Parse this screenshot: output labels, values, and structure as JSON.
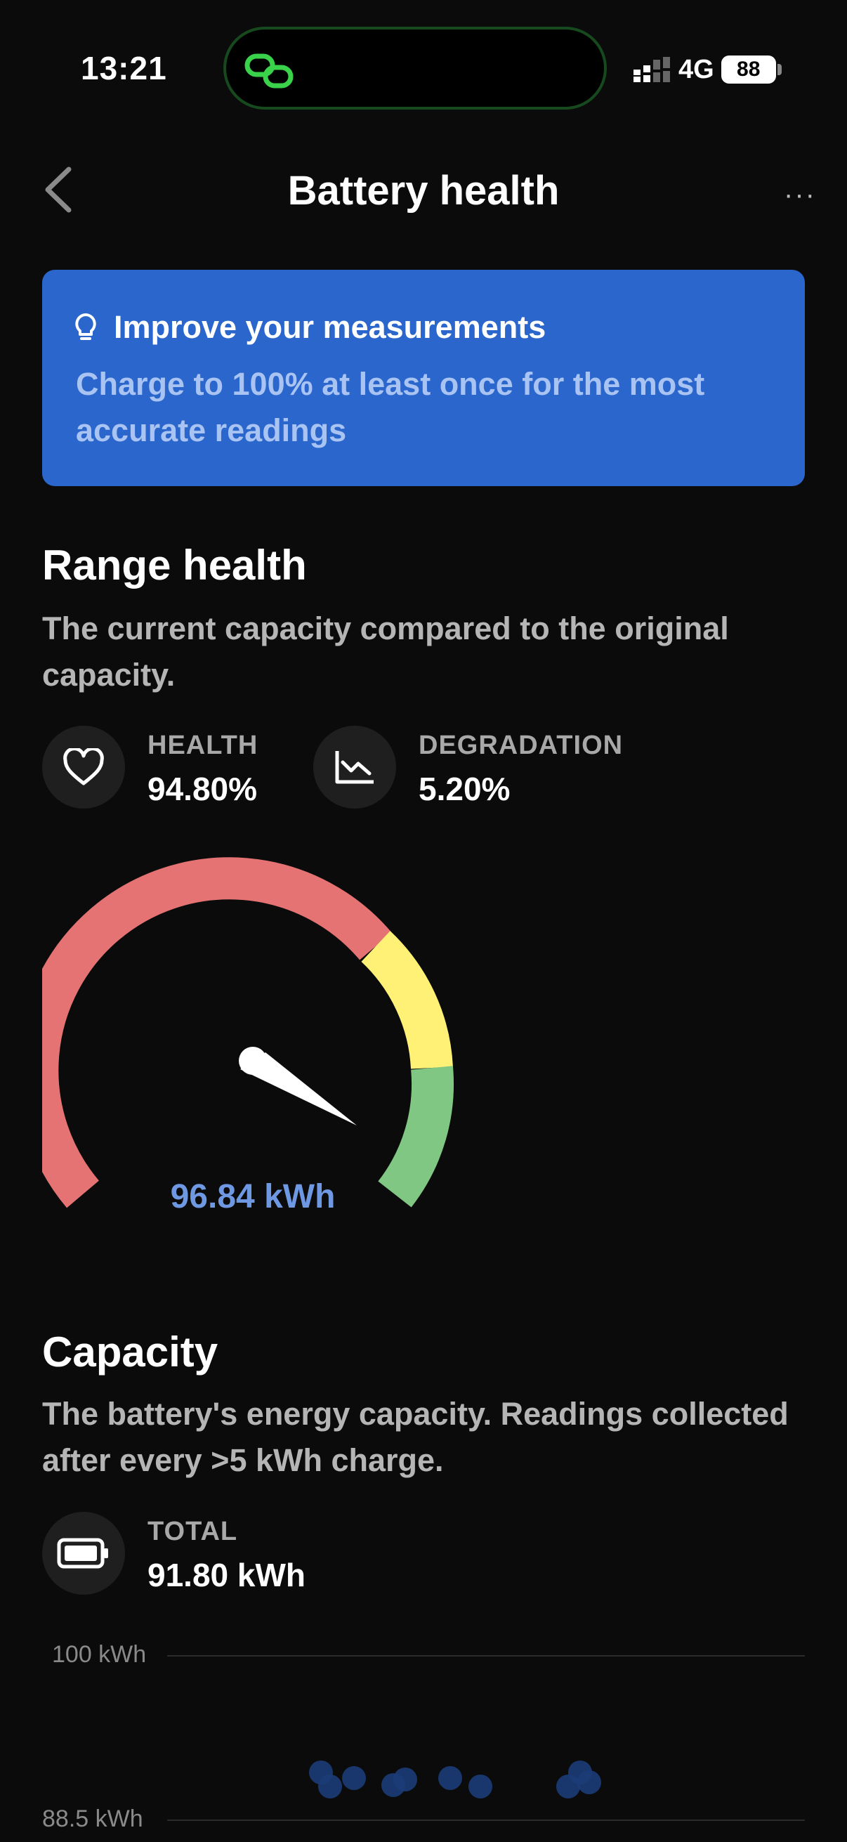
{
  "status_bar": {
    "time": "13:21",
    "network": "4G",
    "battery": "88"
  },
  "nav": {
    "title": "Battery health",
    "more": "···"
  },
  "banner": {
    "title": "Improve your measurements",
    "body": "Charge to 100% at least once for the most accurate readings"
  },
  "range_health": {
    "title": "Range health",
    "description": "The current capacity compared to the original capacity.",
    "health_label": "HEALTH",
    "health_value": "94.80%",
    "degradation_label": "DEGRADATION",
    "degradation_value": "5.20%"
  },
  "gauge": {
    "value_text": "96.84 kWh",
    "colors": {
      "red": "#e57373",
      "yellow": "#fff176",
      "green": "#81c784",
      "needle": "#ffffff"
    }
  },
  "capacity": {
    "title": "Capacity",
    "description": "The battery's energy capacity. Readings collected after every >5 kWh charge.",
    "total_label": "TOTAL",
    "total_value": "91.80 kWh"
  },
  "chart_data": {
    "type": "scatter",
    "title": "",
    "xlabel": "",
    "ylabel": "",
    "ylim": [
      88.5,
      100
    ],
    "y_tick_labels": [
      "100 kWh",
      "88.5 kWh"
    ],
    "points": [
      {
        "x": 0,
        "y": 91.8
      },
      {
        "x": 0.3,
        "y": 90.8
      },
      {
        "x": 1.1,
        "y": 91.4
      },
      {
        "x": 2.4,
        "y": 90.9
      },
      {
        "x": 2.8,
        "y": 91.3
      },
      {
        "x": 4.3,
        "y": 91.4
      },
      {
        "x": 5.3,
        "y": 90.8
      },
      {
        "x": 8.2,
        "y": 90.8
      },
      {
        "x": 8.6,
        "y": 91.8
      },
      {
        "x": 8.9,
        "y": 91.1
      }
    ],
    "xlim": [
      0,
      9
    ],
    "point_color": "#1c3c78",
    "grid": true
  }
}
